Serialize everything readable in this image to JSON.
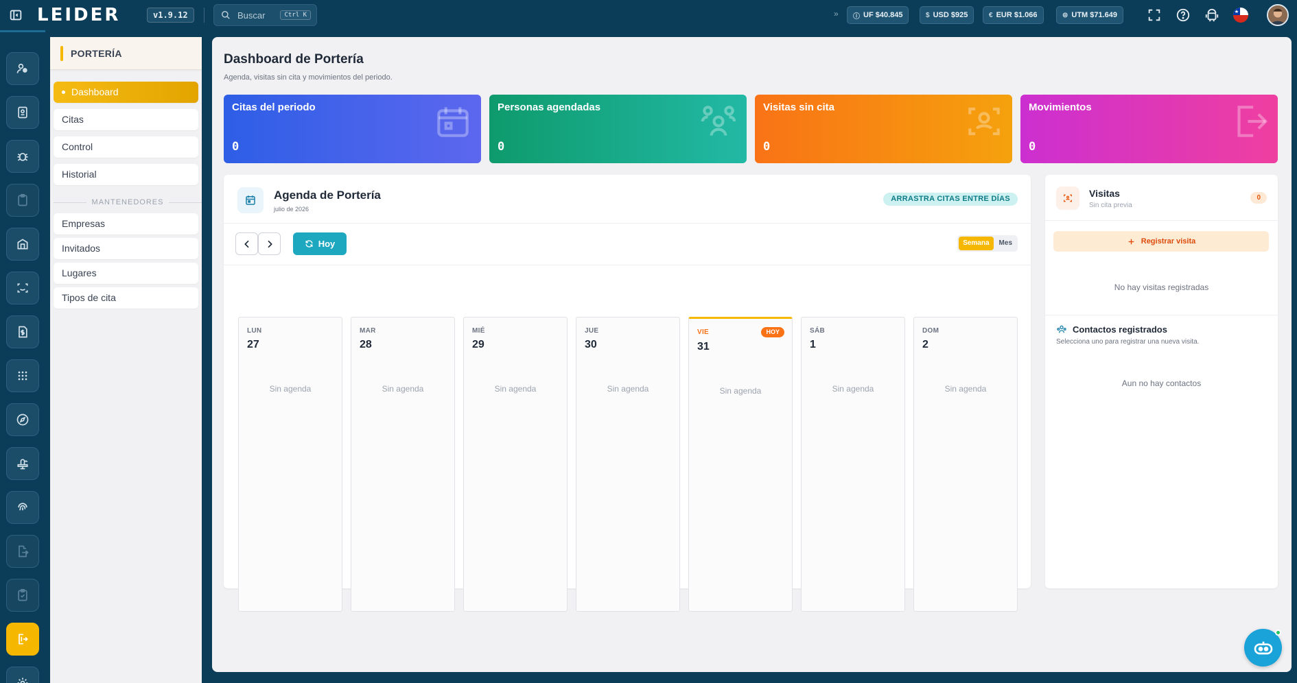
{
  "topbar": {
    "logo": "LEIDER",
    "version": "v1.9.12",
    "search_placeholder": "Buscar",
    "search_shortcut": "Ctrl K",
    "indicators": [
      {
        "icon": "uf-icon",
        "label": "UF $40.845"
      },
      {
        "icon": "dollar-icon",
        "label": "USD $925"
      },
      {
        "icon": "euro-icon",
        "label": "EUR $1.066"
      },
      {
        "icon": "utm-icon",
        "label": "UTM $71.649"
      }
    ],
    "icons": [
      "fullscreen-icon",
      "help-icon",
      "android-icon",
      "chile-flag-icon",
      "user-avatar"
    ]
  },
  "rail": {
    "icons": [
      "users-icon",
      "id-card-icon",
      "bug-icon",
      "clipboard-icon",
      "building-icon",
      "scan-icon",
      "file-dollar-icon",
      "apps-grid-icon",
      "compass-icon",
      "fountain-icon",
      "fingerprint-icon",
      "file-export-icon",
      "clipboard-check-icon",
      "portal-exit-icon",
      "settings-icon"
    ],
    "active": "portal-exit-icon"
  },
  "section": {
    "title": "PORTERÍA",
    "items": [
      "Dashboard",
      "Citas",
      "Control",
      "Historial"
    ],
    "maint_label": "MANTENEDORES",
    "maint_items": [
      "Empresas",
      "Invitados",
      "Lugares",
      "Tipos de cita"
    ]
  },
  "page": {
    "title": "Dashboard de Portería",
    "subtitle": "Agenda, visitas sin cita y movimientos del periodo."
  },
  "stats": [
    {
      "label": "Citas del periodo",
      "value": "0",
      "color": "#2e5ee6",
      "icon": "calendar-icon"
    },
    {
      "label": "Personas agendadas",
      "value": "0",
      "color": "#0e9a6c",
      "icon": "users-group-icon"
    },
    {
      "label": "Visitas sin cita",
      "value": "0",
      "color": "#f97316",
      "icon": "face-scan-icon"
    },
    {
      "label": "Movimientos",
      "value": "0",
      "color": "#cc2fd0",
      "icon": "exit-icon"
    }
  ],
  "agenda": {
    "title": "Agenda de Portería",
    "subtitle": "julio de 2026",
    "badge": "ARRASTRA CITAS ENTRE DÍAS",
    "today_button": "Hoy",
    "view_week": "Semana",
    "view_month": "Mes",
    "today_tag": "HOY",
    "days": [
      {
        "name": "LUN",
        "num": "27",
        "empty": "Sin agenda"
      },
      {
        "name": "MAR",
        "num": "28",
        "empty": "Sin agenda"
      },
      {
        "name": "MIÉ",
        "num": "29",
        "empty": "Sin agenda"
      },
      {
        "name": "JUE",
        "num": "30",
        "empty": "Sin agenda"
      },
      {
        "name": "VIE",
        "num": "31",
        "empty": "Sin agenda"
      },
      {
        "name": "SÁB",
        "num": "1",
        "empty": "Sin agenda"
      },
      {
        "name": "DOM",
        "num": "2",
        "empty": "Sin agenda"
      }
    ]
  },
  "visits": {
    "title": "Visitas",
    "subtitle": "Sin cita previa",
    "count": "0",
    "register_button": "Registrar visita",
    "empty": "No hay visitas registradas",
    "contacts_title": "Contactos registrados",
    "contacts_subtitle": "Selecciona uno para registrar una nueva visita.",
    "contacts_empty": "Aun no hay contactos"
  },
  "colors": {
    "topbar": "#0c3d58",
    "accent": "#f5b700",
    "teal": "#1da8c0"
  }
}
